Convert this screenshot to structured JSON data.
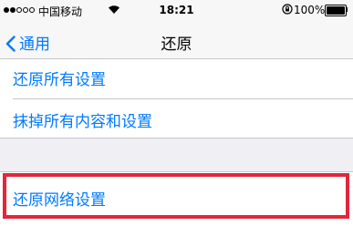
{
  "status_bar": {
    "carrier": "中国移动",
    "time": "18:21",
    "battery": "100%",
    "signal_icon": "signal-dots-icon",
    "wifi_icon": "wifi-icon",
    "lock_icon": "rotation-lock-icon",
    "battery_icon": "battery-icon"
  },
  "nav": {
    "back_label": "通用",
    "title": "还原"
  },
  "reset_options": [
    {
      "label": "还原所有设置"
    },
    {
      "label": "抹掉所有内容和设置"
    },
    {
      "label": "还原网络设置"
    }
  ],
  "colors": {
    "accent": "#007aff",
    "highlight": "#e3263a",
    "background": "#efeff4"
  }
}
